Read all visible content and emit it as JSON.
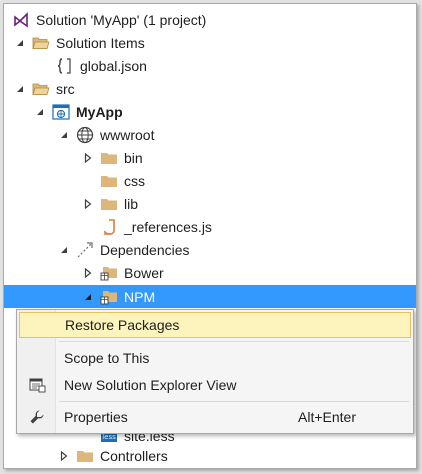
{
  "tree": {
    "solution": "Solution 'MyApp' (1 project)",
    "solution_items": "Solution Items",
    "global_json": "global.json",
    "src": "src",
    "project": "MyApp",
    "wwwroot": "wwwroot",
    "bin": "bin",
    "css": "css",
    "lib": "lib",
    "references_js": "_references.js",
    "dependencies": "Dependencies",
    "bower": "Bower",
    "npm": "NPM",
    "site_less": "site.less",
    "controllers": "Controllers"
  },
  "context_menu": {
    "restore_packages": "Restore Packages",
    "scope_to_this": "Scope to This",
    "new_view": "New Solution Explorer View",
    "properties": "Properties",
    "properties_shortcut": "Alt+Enter"
  },
  "colors": {
    "selection": "#3399ff",
    "folder": "#dcb67a",
    "vs_purple": "#68217a",
    "menu_highlight": "#fcf4bc"
  }
}
